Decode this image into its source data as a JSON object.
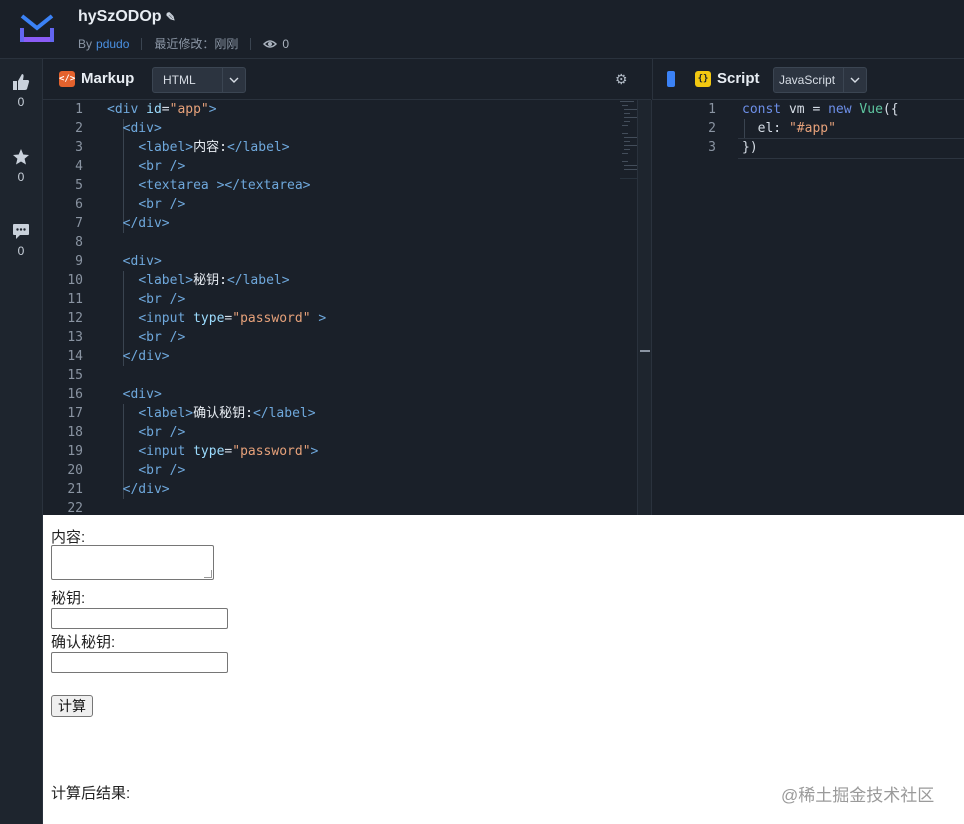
{
  "header": {
    "title": "hySzODOp",
    "by_label": "By",
    "author": "pdudo",
    "modified": "最近修改：刚刚",
    "views": "0"
  },
  "sidebar": {
    "likes": "0",
    "stars": "0",
    "comments": "0"
  },
  "markup_panel": {
    "title": "Markup",
    "language": "HTML",
    "lines": [
      {
        "n": "1",
        "html": "<span class='t'>&lt;div</span> <span class='a'>id</span>=<span class='s'>\"app\"</span><span class='t'>&gt;</span>"
      },
      {
        "n": "2",
        "html": "  <span class='t'>&lt;div&gt;</span>"
      },
      {
        "n": "3",
        "html": "    <span class='t'>&lt;label&gt;</span><span class='txt'>内容:</span><span class='t'>&lt;/label&gt;</span>"
      },
      {
        "n": "4",
        "html": "    <span class='t'>&lt;br /&gt;</span>"
      },
      {
        "n": "5",
        "html": "    <span class='t'>&lt;textarea &gt;&lt;/textarea&gt;</span>"
      },
      {
        "n": "6",
        "html": "    <span class='t'>&lt;br /&gt;</span>"
      },
      {
        "n": "7",
        "html": "  <span class='t'>&lt;/div&gt;</span>"
      },
      {
        "n": "8",
        "html": ""
      },
      {
        "n": "9",
        "html": "  <span class='t'>&lt;div&gt;</span>"
      },
      {
        "n": "10",
        "html": "    <span class='t'>&lt;label&gt;</span><span class='txt'>秘钥:</span><span class='t'>&lt;/label&gt;</span>"
      },
      {
        "n": "11",
        "html": "    <span class='t'>&lt;br /&gt;</span>"
      },
      {
        "n": "12",
        "html": "    <span class='t'>&lt;input</span> <span class='a'>type</span>=<span class='s'>\"password\"</span> <span class='t'>&gt;</span>"
      },
      {
        "n": "13",
        "html": "    <span class='t'>&lt;br /&gt;</span>"
      },
      {
        "n": "14",
        "html": "  <span class='t'>&lt;/div&gt;</span>"
      },
      {
        "n": "15",
        "html": ""
      },
      {
        "n": "16",
        "html": "  <span class='t'>&lt;div&gt;</span>"
      },
      {
        "n": "17",
        "html": "    <span class='t'>&lt;label&gt;</span><span class='txt'>确认秘钥:</span><span class='t'>&lt;/label&gt;</span>"
      },
      {
        "n": "18",
        "html": "    <span class='t'>&lt;br /&gt;</span>"
      },
      {
        "n": "19",
        "html": "    <span class='t'>&lt;input</span> <span class='a'>type</span>=<span class='s'>\"password\"</span><span class='t'>&gt;</span>"
      },
      {
        "n": "20",
        "html": "    <span class='t'>&lt;br /&gt;</span>"
      },
      {
        "n": "21",
        "html": "  <span class='t'>&lt;/div&gt;</span>"
      },
      {
        "n": "22",
        "html": ""
      }
    ]
  },
  "script_panel": {
    "title": "Script",
    "language": "JavaScript",
    "lines": [
      {
        "n": "1",
        "html": "<span class='kw'>const</span> vm = <span class='kw'>new</span> <span class='fn'>Vue</span>({"
      },
      {
        "n": "2",
        "html": "  el: <span class='s'>\"#app\"</span>"
      },
      {
        "n": "3",
        "html": "})"
      }
    ]
  },
  "preview": {
    "content_label": "内容:",
    "secret_label": "秘钥:",
    "confirm_label": "确认秘钥:",
    "calc_button": "计算",
    "result_label": "计算后结果:",
    "watermark": "@稀土掘金技术社区"
  }
}
